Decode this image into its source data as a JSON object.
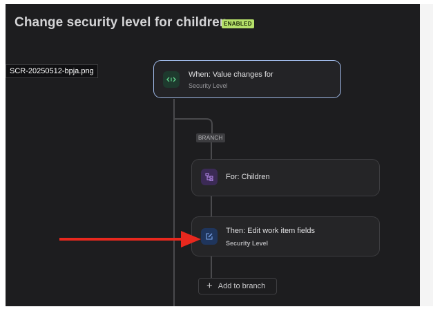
{
  "header": {
    "title": "Change security level for children",
    "status_badge": "ENABLED"
  },
  "file_label": "SCR-20250512-bpja.png",
  "flow": {
    "trigger": {
      "title": "When: Value changes for",
      "subtitle": "Security Level",
      "icon": "code-brackets-icon"
    },
    "branch_label": "BRANCH",
    "for_step": {
      "title": "For: Children",
      "icon": "hierarchy-icon"
    },
    "action_step": {
      "title": "Then: Edit work item fields",
      "subtitle": "Security Level",
      "icon": "edit-icon"
    },
    "add_to_branch_label": "Add to branch"
  },
  "colors": {
    "badge_green": "#b5e06a",
    "trigger_border": "#9fb9e8",
    "arrow_red": "#e8281e"
  }
}
